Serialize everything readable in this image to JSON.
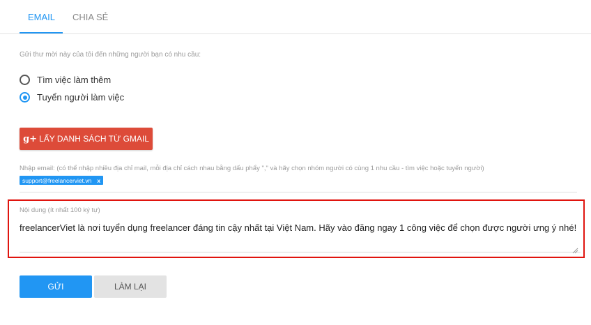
{
  "tabs": {
    "email": "EMAIL",
    "share": "CHIA SẺ"
  },
  "intro_text": "Gửi thư mời này của tôi đến những người bạn có nhu cầu:",
  "options": [
    {
      "label": "Tìm việc làm thêm",
      "selected": false
    },
    {
      "label": "Tuyển người làm việc",
      "selected": true
    }
  ],
  "gmail_button": {
    "icon": "g+",
    "label": "LẤY DANH SÁCH TỪ GMAIL"
  },
  "email_input": {
    "label": "Nhập email: (có thể nhập nhiều địa chỉ mail, mỗi địa chỉ cách nhau bằng dấu phẩy \",\" và hãy chọn nhóm người có cùng 1 nhu cầu - tìm việc hoặc tuyển người)",
    "tags": [
      "support@freelancerviet.vn"
    ],
    "remove_symbol": "x"
  },
  "content": {
    "label": "Nội dung (ít nhất 100 ký tự)",
    "value": "freelancerViet là nơi tuyển dụng freelancer đáng tin cậy nhất tại Việt Nam. Hãy vào đăng ngay 1 công việc để chọn được người ưng ý nhé!"
  },
  "buttons": {
    "send": "GỬI",
    "reset": "LÀM LẠI"
  },
  "colors": {
    "accent": "#2196f3",
    "gmail": "#dd4b39",
    "highlight": "#e0140e"
  }
}
